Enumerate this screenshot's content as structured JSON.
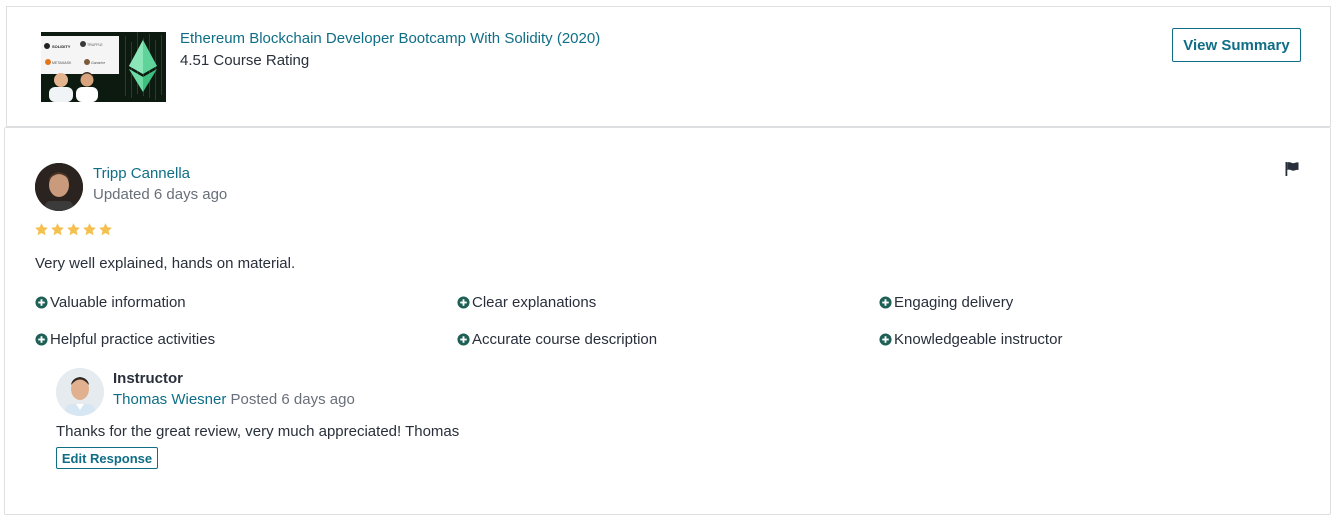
{
  "course": {
    "title": "Ethereum Blockchain Developer Bootcamp With Solidity (2020)",
    "rating_text": "4.51 Course Rating",
    "view_summary_label": "View Summary",
    "thumbnail_texts": [
      "SOLIDITY",
      "TRUFFLE",
      "METAMASK",
      "Ganache"
    ]
  },
  "review": {
    "reviewer_name": "Tripp Cannella",
    "updated": "Updated 6 days ago",
    "stars": 5,
    "text": "Very well explained, hands on material.",
    "tags": [
      "Valuable information",
      "Clear explanations",
      "Engaging delivery",
      "Helpful practice activities",
      "Accurate course description",
      "Knowledgeable instructor"
    ]
  },
  "response": {
    "role": "Instructor",
    "name": "Thomas Wiesner",
    "posted": "Posted 6 days ago",
    "text": "Thanks for the great review, very much appreciated! Thomas",
    "edit_label": "Edit Response"
  },
  "colors": {
    "link": "#0f6e86",
    "star": "#f4c150",
    "tag_icon": "#1e6055",
    "flag": "#29303b"
  }
}
